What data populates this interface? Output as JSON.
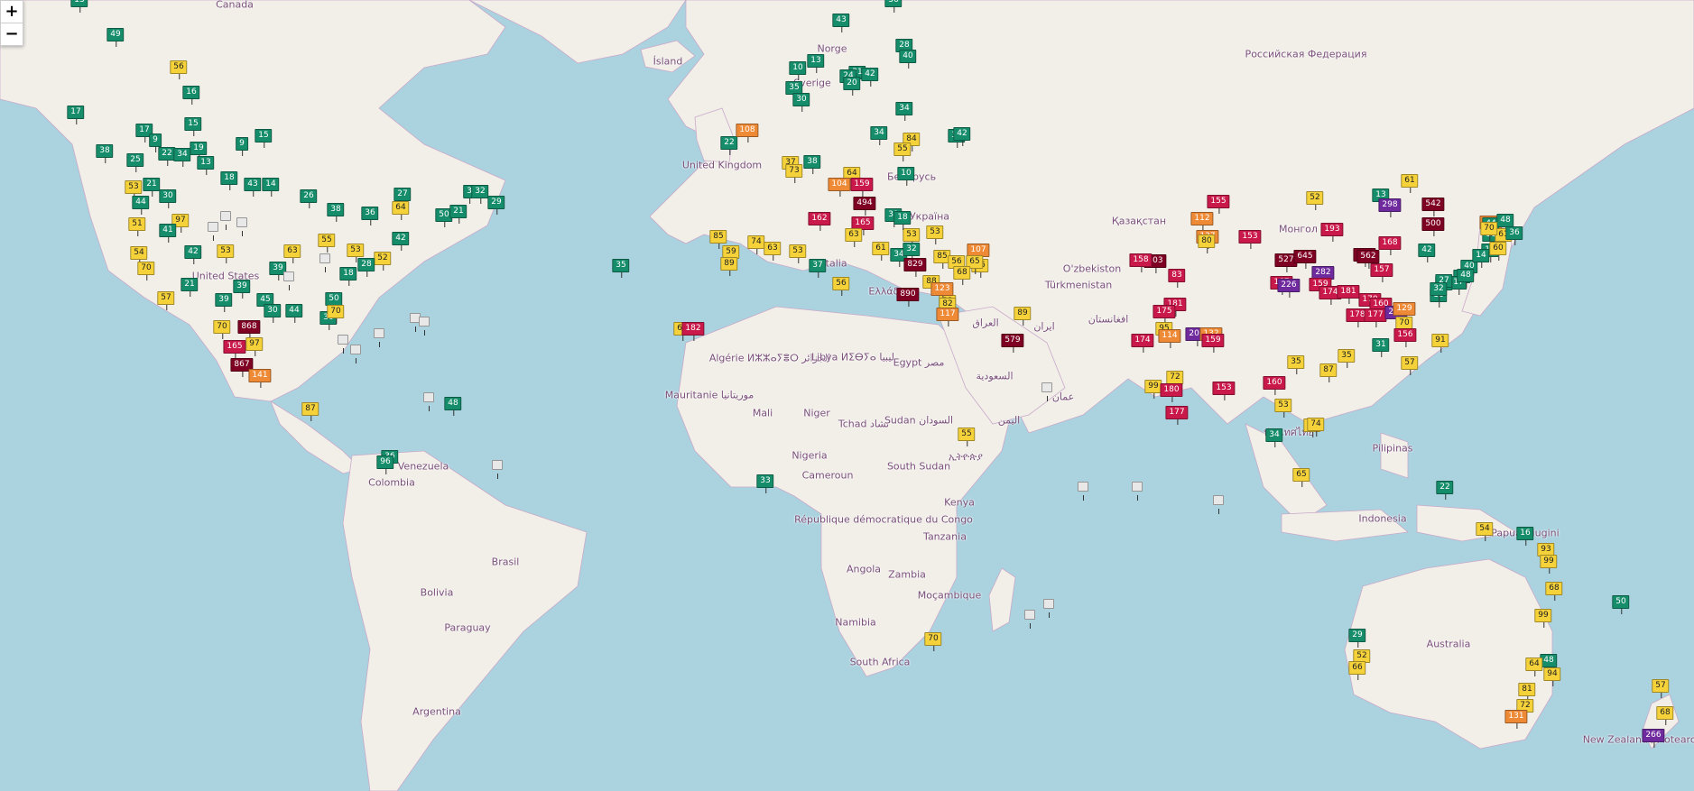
{
  "colors": {
    "water": "#aad3df",
    "land": "#f2efe9",
    "good": "#168d6a",
    "moderate": "#f5d23a",
    "usg": "#ee8a36",
    "unhealthy": "#c9184a",
    "very_unhealthy": "#6f2a9e",
    "hazardous": "#7e0023",
    "nodata": "#e8e8e8"
  },
  "zoom": {
    "in_label": "+",
    "out_label": "−"
  },
  "places": [
    {
      "name": "Canada"
    },
    {
      "name": "Ísland"
    },
    {
      "name": "Norge"
    },
    {
      "name": "Sverige"
    },
    {
      "name": "Российская Федерация"
    },
    {
      "name": "United Kingdom"
    },
    {
      "name": "Беларусь"
    },
    {
      "name": "Україна"
    },
    {
      "name": "Қазақстан"
    },
    {
      "name": "Монгол улс"
    },
    {
      "name": "O'zbekiston"
    },
    {
      "name": "Türkmenistan"
    },
    {
      "name": "Ελλάδα"
    },
    {
      "name": "Italia"
    },
    {
      "name": "United States"
    },
    {
      "name": "Algérie ⵍⵣⵣⴰⵢⴻⵔ الجزائر"
    },
    {
      "name": "Libya ⵍⵉⴱⵢⴰ ليبيا"
    },
    {
      "name": "Egypt مصر"
    },
    {
      "name": "العراق"
    },
    {
      "name": "ایران"
    },
    {
      "name": "افغانستان"
    },
    {
      "name": "السعودية"
    },
    {
      "name": "عمان"
    },
    {
      "name": "اليمن"
    },
    {
      "name": "Mauritanie موريتانيا"
    },
    {
      "name": "Mali"
    },
    {
      "name": "Niger"
    },
    {
      "name": "Tchad تشاد"
    },
    {
      "name": "Sudan السودان"
    },
    {
      "name": "Nigeria"
    },
    {
      "name": "Cameroun"
    },
    {
      "name": "South Sudan"
    },
    {
      "name": "ኢትዮጵያ"
    },
    {
      "name": "Kenya"
    },
    {
      "name": "République démocratique du Congo"
    },
    {
      "name": "Tanzania"
    },
    {
      "name": "Angola"
    },
    {
      "name": "Zambia"
    },
    {
      "name": "Moçambique"
    },
    {
      "name": "Namibia"
    },
    {
      "name": "South Africa"
    },
    {
      "name": "Venezuela"
    },
    {
      "name": "Colombia"
    },
    {
      "name": "Brasil"
    },
    {
      "name": "Bolivia"
    },
    {
      "name": "Paraguay"
    },
    {
      "name": "Argentina"
    },
    {
      "name": "Indonesia"
    },
    {
      "name": "Papua Niugini"
    },
    {
      "name": "Australia"
    },
    {
      "name": "Pilipinas"
    },
    {
      "name": "ประเทศไทย"
    },
    {
      "name": "New Zealand / Aotearoa"
    }
  ],
  "stations": [
    {
      "v": "13",
      "c": "good"
    },
    {
      "v": "49",
      "c": "good"
    },
    {
      "v": "56",
      "c": "moderate"
    },
    {
      "v": "16",
      "c": "good"
    },
    {
      "v": "17",
      "c": "good"
    },
    {
      "v": "15",
      "c": "good"
    },
    {
      "v": "17",
      "c": "good"
    },
    {
      "v": "9",
      "c": "good"
    },
    {
      "v": "9",
      "c": "good"
    },
    {
      "v": "15",
      "c": "good"
    },
    {
      "v": "38",
      "c": "good"
    },
    {
      "v": "19",
      "c": "good"
    },
    {
      "v": "22",
      "c": "good"
    },
    {
      "v": "34",
      "c": "good"
    },
    {
      "v": "13",
      "c": "good"
    },
    {
      "v": "25",
      "c": "good"
    },
    {
      "v": "18",
      "c": "good"
    },
    {
      "v": "43",
      "c": "good"
    },
    {
      "v": "14",
      "c": "good"
    },
    {
      "v": "53",
      "c": "moderate"
    },
    {
      "v": "21",
      "c": "good"
    },
    {
      "v": "30",
      "c": "good"
    },
    {
      "v": "44",
      "c": "good"
    },
    {
      "v": "26",
      "c": "good"
    },
    {
      "v": "97",
      "c": "moderate"
    },
    {
      "v": "51",
      "c": "moderate"
    },
    {
      "v": "41",
      "c": "good"
    },
    {
      "v": "54",
      "c": "moderate"
    },
    {
      "v": "42",
      "c": "good"
    },
    {
      "v": "70",
      "c": "moderate"
    },
    {
      "v": "53",
      "c": "moderate"
    },
    {
      "v": "63",
      "c": "moderate"
    },
    {
      "v": "55",
      "c": "moderate"
    },
    {
      "v": "39",
      "c": "good"
    },
    {
      "v": "38",
      "c": "good"
    },
    {
      "v": "36",
      "c": "good"
    },
    {
      "v": "27",
      "c": "good"
    },
    {
      "v": "64",
      "c": "moderate"
    },
    {
      "v": "3",
      "c": "good"
    },
    {
      "v": "32",
      "c": "good"
    },
    {
      "v": "29",
      "c": "good"
    },
    {
      "v": "50",
      "c": "good"
    },
    {
      "v": "21",
      "c": "good"
    },
    {
      "v": "42",
      "c": "good"
    },
    {
      "v": "52",
      "c": "moderate"
    },
    {
      "v": "53",
      "c": "moderate"
    },
    {
      "v": "28",
      "c": "good"
    },
    {
      "v": "18",
      "c": "good"
    },
    {
      "v": "21",
      "c": "good"
    },
    {
      "v": "39",
      "c": "good"
    },
    {
      "v": "57",
      "c": "moderate"
    },
    {
      "v": "39",
      "c": "good"
    },
    {
      "v": "45",
      "c": "good"
    },
    {
      "v": "30",
      "c": "good"
    },
    {
      "v": "50",
      "c": "good"
    },
    {
      "v": "70",
      "c": "moderate"
    },
    {
      "v": "30",
      "c": "good"
    },
    {
      "v": "44",
      "c": "good"
    },
    {
      "v": "70",
      "c": "moderate"
    },
    {
      "v": "868",
      "c": "hazardous"
    },
    {
      "v": "165",
      "c": "unhealthy"
    },
    {
      "v": "97",
      "c": "moderate"
    },
    {
      "v": "867",
      "c": "hazardous"
    },
    {
      "v": "141",
      "c": "usg"
    },
    {
      "v": "87",
      "c": "moderate"
    },
    {
      "v": "48",
      "c": "good"
    },
    {
      "v": "35",
      "c": "good"
    },
    {
      "v": "43",
      "c": "good"
    },
    {
      "v": "36",
      "c": "good"
    },
    {
      "v": "28",
      "c": "good"
    },
    {
      "v": "40",
      "c": "good"
    },
    {
      "v": "10",
      "c": "good"
    },
    {
      "v": "13",
      "c": "good"
    },
    {
      "v": "31",
      "c": "good"
    },
    {
      "v": "35",
      "c": "good"
    },
    {
      "v": "24",
      "c": "good"
    },
    {
      "v": "30",
      "c": "good"
    },
    {
      "v": "42",
      "c": "good"
    },
    {
      "v": "20",
      "c": "good"
    },
    {
      "v": "34",
      "c": "good"
    },
    {
      "v": "34",
      "c": "good"
    },
    {
      "v": "22",
      "c": "good"
    },
    {
      "v": "108",
      "c": "usg"
    },
    {
      "v": "37",
      "c": "moderate"
    },
    {
      "v": "38",
      "c": "good"
    },
    {
      "v": "73",
      "c": "moderate"
    },
    {
      "v": "84",
      "c": "moderate"
    },
    {
      "v": "10",
      "c": "good"
    },
    {
      "v": "64",
      "c": "moderate"
    },
    {
      "v": "38",
      "c": "good"
    },
    {
      "v": "42",
      "c": "good"
    },
    {
      "v": "55",
      "c": "moderate"
    },
    {
      "v": "104",
      "c": "usg"
    },
    {
      "v": "159",
      "c": "unhealthy"
    },
    {
      "v": "494",
      "c": "hazardous"
    },
    {
      "v": "162",
      "c": "unhealthy"
    },
    {
      "v": "165",
      "c": "unhealthy"
    },
    {
      "v": "63",
      "c": "moderate"
    },
    {
      "v": "53",
      "c": "moderate"
    },
    {
      "v": "53",
      "c": "moderate"
    },
    {
      "v": "74",
      "c": "moderate"
    },
    {
      "v": "85",
      "c": "moderate"
    },
    {
      "v": "59",
      "c": "moderate"
    },
    {
      "v": "63",
      "c": "moderate"
    },
    {
      "v": "53",
      "c": "moderate"
    },
    {
      "v": "89",
      "c": "moderate"
    },
    {
      "v": "37",
      "c": "good"
    },
    {
      "v": "61",
      "c": "moderate"
    },
    {
      "v": "31",
      "c": "good"
    },
    {
      "v": "18",
      "c": "good"
    },
    {
      "v": "34",
      "c": "good"
    },
    {
      "v": "32",
      "c": "good"
    },
    {
      "v": "56",
      "c": "moderate"
    },
    {
      "v": "85",
      "c": "moderate"
    },
    {
      "v": "829",
      "c": "hazardous"
    },
    {
      "v": "107",
      "c": "usg"
    },
    {
      "v": "56",
      "c": "moderate"
    },
    {
      "v": "890",
      "c": "hazardous"
    },
    {
      "v": "88",
      "c": "moderate"
    },
    {
      "v": "83",
      "c": "moderate"
    },
    {
      "v": "123",
      "c": "usg"
    },
    {
      "v": "82",
      "c": "moderate"
    },
    {
      "v": "56",
      "c": "moderate"
    },
    {
      "v": "65",
      "c": "moderate"
    },
    {
      "v": "68",
      "c": "moderate"
    },
    {
      "v": "117",
      "c": "usg"
    },
    {
      "v": "68",
      "c": "moderate"
    },
    {
      "v": "182",
      "c": "unhealthy"
    },
    {
      "v": "33",
      "c": "good"
    },
    {
      "v": "55",
      "c": "moderate"
    },
    {
      "v": "89",
      "c": "moderate"
    },
    {
      "v": "579",
      "c": "hazardous"
    },
    {
      "v": "52",
      "c": "moderate"
    },
    {
      "v": "155",
      "c": "unhealthy"
    },
    {
      "v": "112",
      "c": "usg"
    },
    {
      "v": "137",
      "c": "usg"
    },
    {
      "v": "80",
      "c": "moderate"
    },
    {
      "v": "153",
      "c": "unhealthy"
    },
    {
      "v": "303",
      "c": "hazardous"
    },
    {
      "v": "158",
      "c": "unhealthy"
    },
    {
      "v": "83",
      "c": "unhealthy"
    },
    {
      "v": "181",
      "c": "unhealthy"
    },
    {
      "v": "175",
      "c": "unhealthy"
    },
    {
      "v": "95",
      "c": "moderate"
    },
    {
      "v": "174",
      "c": "unhealthy"
    },
    {
      "v": "114",
      "c": "usg"
    },
    {
      "v": "203",
      "c": "very_unhealthy"
    },
    {
      "v": "132",
      "c": "usg"
    },
    {
      "v": "159",
      "c": "unhealthy"
    },
    {
      "v": "72",
      "c": "moderate"
    },
    {
      "v": "99",
      "c": "moderate"
    },
    {
      "v": "180",
      "c": "unhealthy"
    },
    {
      "v": "153",
      "c": "unhealthy"
    },
    {
      "v": "177",
      "c": "unhealthy"
    },
    {
      "v": "13",
      "c": "good"
    },
    {
      "v": "61",
      "c": "moderate"
    },
    {
      "v": "298",
      "c": "very_unhealthy"
    },
    {
      "v": "542",
      "c": "hazardous"
    },
    {
      "v": "500",
      "c": "hazardous"
    },
    {
      "v": "114",
      "c": "usg"
    },
    {
      "v": "193",
      "c": "unhealthy"
    },
    {
      "v": "168",
      "c": "unhealthy"
    },
    {
      "v": "999",
      "c": "hazardous"
    },
    {
      "v": "562",
      "c": "hazardous"
    },
    {
      "v": "527",
      "c": "hazardous"
    },
    {
      "v": "645",
      "c": "hazardous"
    },
    {
      "v": "282",
      "c": "very_unhealthy"
    },
    {
      "v": "167",
      "c": "unhealthy"
    },
    {
      "v": "226",
      "c": "very_unhealthy"
    },
    {
      "v": "159",
      "c": "unhealthy"
    },
    {
      "v": "174",
      "c": "unhealthy"
    },
    {
      "v": "181",
      "c": "unhealthy"
    },
    {
      "v": "157",
      "c": "unhealthy"
    },
    {
      "v": "170",
      "c": "unhealthy"
    },
    {
      "v": "178",
      "c": "unhealthy"
    },
    {
      "v": "160",
      "c": "unhealthy"
    },
    {
      "v": "177",
      "c": "unhealthy"
    },
    {
      "v": "212",
      "c": "very_unhealthy"
    },
    {
      "v": "129",
      "c": "usg"
    },
    {
      "v": "70",
      "c": "moderate"
    },
    {
      "v": "156",
      "c": "unhealthy"
    },
    {
      "v": "31",
      "c": "good"
    },
    {
      "v": "35",
      "c": "moderate"
    },
    {
      "v": "87",
      "c": "moderate"
    },
    {
      "v": "35",
      "c": "moderate"
    },
    {
      "v": "160",
      "c": "unhealthy"
    },
    {
      "v": "53",
      "c": "moderate"
    },
    {
      "v": "34",
      "c": "good"
    },
    {
      "v": "63",
      "c": "moderate"
    },
    {
      "v": "65",
      "c": "moderate"
    },
    {
      "v": "74",
      "c": "moderate"
    },
    {
      "v": "57",
      "c": "moderate"
    },
    {
      "v": "91",
      "c": "moderate"
    },
    {
      "v": "40",
      "c": "good"
    },
    {
      "v": "13",
      "c": "good"
    },
    {
      "v": "14",
      "c": "good"
    },
    {
      "v": "15",
      "c": "good"
    },
    {
      "v": "17",
      "c": "good"
    },
    {
      "v": "34",
      "c": "good"
    },
    {
      "v": "48",
      "c": "good"
    },
    {
      "v": "18",
      "c": "good"
    },
    {
      "v": "13",
      "c": "good"
    },
    {
      "v": "27",
      "c": "good"
    },
    {
      "v": "32",
      "c": "good"
    },
    {
      "v": "42",
      "c": "good"
    },
    {
      "v": "44",
      "c": "good"
    },
    {
      "v": "48",
      "c": "good"
    },
    {
      "v": "61",
      "c": "moderate"
    },
    {
      "v": "60",
      "c": "moderate"
    },
    {
      "v": "70",
      "c": "moderate"
    },
    {
      "v": "36",
      "c": "good"
    },
    {
      "v": "22",
      "c": "good"
    },
    {
      "v": "54",
      "c": "moderate"
    },
    {
      "v": "16",
      "c": "good"
    },
    {
      "v": "93",
      "c": "moderate"
    },
    {
      "v": "99",
      "c": "moderate"
    },
    {
      "v": "68",
      "c": "moderate"
    },
    {
      "v": "99",
      "c": "moderate"
    },
    {
      "v": "50",
      "c": "good"
    },
    {
      "v": "29",
      "c": "good"
    },
    {
      "v": "52",
      "c": "moderate"
    },
    {
      "v": "66",
      "c": "moderate"
    },
    {
      "v": "48",
      "c": "good"
    },
    {
      "v": "64",
      "c": "moderate"
    },
    {
      "v": "94",
      "c": "moderate"
    },
    {
      "v": "81",
      "c": "moderate"
    },
    {
      "v": "72",
      "c": "moderate"
    },
    {
      "v": "131",
      "c": "usg"
    },
    {
      "v": "266",
      "c": "very_unhealthy"
    },
    {
      "v": "57",
      "c": "moderate"
    },
    {
      "v": "68",
      "c": "moderate"
    },
    {
      "v": "70",
      "c": "moderate"
    },
    {
      "v": "36",
      "c": "good"
    },
    {
      "v": "96",
      "c": "good"
    }
  ],
  "nodata_count": 18
}
